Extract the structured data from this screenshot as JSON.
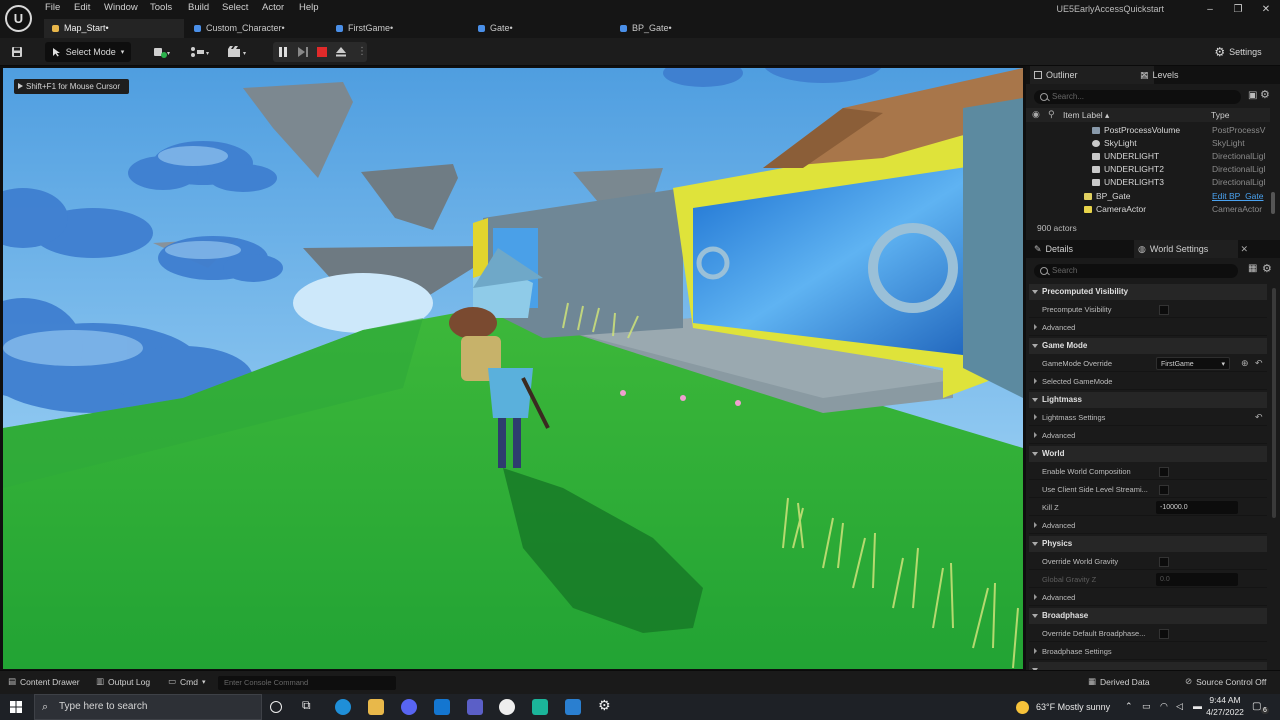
{
  "menu": [
    "File",
    "Edit",
    "Window",
    "Tools",
    "Build",
    "Select",
    "Actor",
    "Help"
  ],
  "project_name": "UE5EarlyAccessQuickstart",
  "tabs": [
    {
      "label": "Map_Start•",
      "active": true,
      "color": "#e8b64a"
    },
    {
      "label": "Custom_Character•",
      "active": false,
      "color": "#4a8fe8"
    },
    {
      "label": "FirstGame•",
      "active": false,
      "color": "#4a8fe8"
    },
    {
      "label": "Gate•",
      "active": false,
      "color": "#4a8fe8"
    },
    {
      "label": "BP_Gate•",
      "active": false,
      "color": "#4a8fe8"
    }
  ],
  "toolbar": {
    "select_mode": "Select Mode",
    "settings": "Settings"
  },
  "viewport": {
    "mouse_hint": "Shift+F1 for Mouse Cursor"
  },
  "outliner": {
    "tab_label": "Outliner",
    "levels_label": "Levels",
    "search_placeholder": "Search...",
    "col_label": "Item Label ▴",
    "col_type": "Type",
    "rows": [
      {
        "name": "PostProcessVolume",
        "type": "PostProcessV",
        "indent": 1
      },
      {
        "name": "SkyLight",
        "type": "SkyLight",
        "indent": 1
      },
      {
        "name": "UNDERLIGHT",
        "type": "DirectionalLigl",
        "indent": 1
      },
      {
        "name": "UNDERLIGHT2",
        "type": "DirectionalLigl",
        "indent": 1
      },
      {
        "name": "UNDERLIGHT3",
        "type": "DirectionalLigl",
        "indent": 1
      },
      {
        "name": "BP_Gate",
        "type": "Edit BP_Gate",
        "indent": 0
      },
      {
        "name": "CameraActor",
        "type": "CameraActor",
        "indent": 0
      }
    ],
    "actor_count": "900 actors"
  },
  "details": {
    "tab_label": "Details",
    "world_settings_label": "World Settings",
    "search_placeholder": "Search",
    "sections": [
      {
        "title": "Precomputed Visibility",
        "props": [
          {
            "label": "Precompute Visibility",
            "kind": "check"
          },
          {
            "label": "Advanced",
            "kind": "adv"
          }
        ]
      },
      {
        "title": "Game Mode",
        "props": [
          {
            "label": "GameMode Override",
            "kind": "select",
            "value": "FirstGame"
          },
          {
            "label": "Selected GameMode",
            "kind": "adv"
          }
        ]
      },
      {
        "title": "Lightmass",
        "props": [
          {
            "label": "Lightmass Settings",
            "kind": "adv-reset"
          },
          {
            "label": "Advanced",
            "kind": "adv"
          }
        ]
      },
      {
        "title": "World",
        "props": [
          {
            "label": "Enable World Composition",
            "kind": "check"
          },
          {
            "label": "Use Client Side Level Streami...",
            "kind": "check"
          },
          {
            "label": "Kill Z",
            "kind": "field",
            "value": "-10000.0"
          },
          {
            "label": "Advanced",
            "kind": "adv"
          }
        ]
      },
      {
        "title": "Physics",
        "props": [
          {
            "label": "Override World Gravity",
            "kind": "check"
          },
          {
            "label": "Global Gravity Z",
            "kind": "field-dim",
            "value": "0.0"
          },
          {
            "label": "Advanced",
            "kind": "adv"
          }
        ]
      },
      {
        "title": "Broadphase",
        "props": [
          {
            "label": "Override Default Broadphase...",
            "kind": "check"
          },
          {
            "label": "Broadphase Settings",
            "kind": "adv"
          }
        ]
      }
    ]
  },
  "statusbar": {
    "content_drawer": "Content Drawer",
    "output_log": "Output Log",
    "cmd": "Cmd",
    "console_placeholder": "Enter Console Command",
    "derived_data": "Derived Data",
    "source_control": "Source Control Off"
  },
  "taskbar": {
    "search_placeholder": "Type here to search",
    "weather": "63°F  Mostly sunny",
    "time": "9:44 AM",
    "date": "4/27/2022",
    "notifications": "6"
  }
}
